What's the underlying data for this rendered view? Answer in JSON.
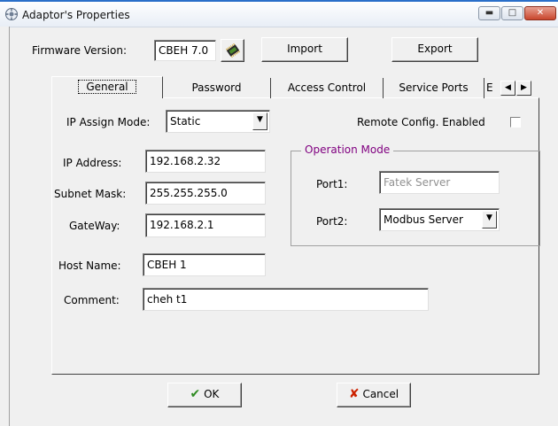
{
  "window": {
    "title": "Adaptor's Properties",
    "controls": [
      "minimize",
      "maximize",
      "close"
    ]
  },
  "firmware": {
    "label": "Firmware Version:",
    "value": "CBEH 7.0",
    "chip_icon": "chip-icon"
  },
  "toolbar": {
    "import_label": "Import",
    "export_label": "Export"
  },
  "tabs": [
    {
      "label": "General",
      "active": true
    },
    {
      "label": "Password"
    },
    {
      "label": "Access Control"
    },
    {
      "label": "Service Ports"
    },
    {
      "label": "E"
    }
  ],
  "general": {
    "ip_assign_label": "IP Assign Mode:",
    "ip_assign_value": "Static",
    "remote_config_label": "Remote Config. Enabled",
    "remote_config_checked": false,
    "ip_address_label": "IP Address:",
    "ip_address_value": "192.168.2.32",
    "subnet_label": "Subnet Mask:",
    "subnet_value": "255.255.255.0",
    "gateway_label": "GateWay:",
    "gateway_value": "192.168.2.1",
    "host_label": "Host Name:",
    "host_value": "CBEH 1",
    "comment_label": "Comment:",
    "comment_value": "cheh t1"
  },
  "operation_mode": {
    "title": "Operation Mode",
    "port1_label": "Port1:",
    "port1_value": "Fatek Server",
    "port2_label": "Port2:",
    "port2_value": "Modbus Server"
  },
  "footer": {
    "ok_label": "OK",
    "cancel_label": "Cancel"
  },
  "colors": {
    "group_title": "#800080",
    "ok_check": "#2e8b22",
    "cancel_x": "#cc2200",
    "disabled_text": "#909090"
  }
}
